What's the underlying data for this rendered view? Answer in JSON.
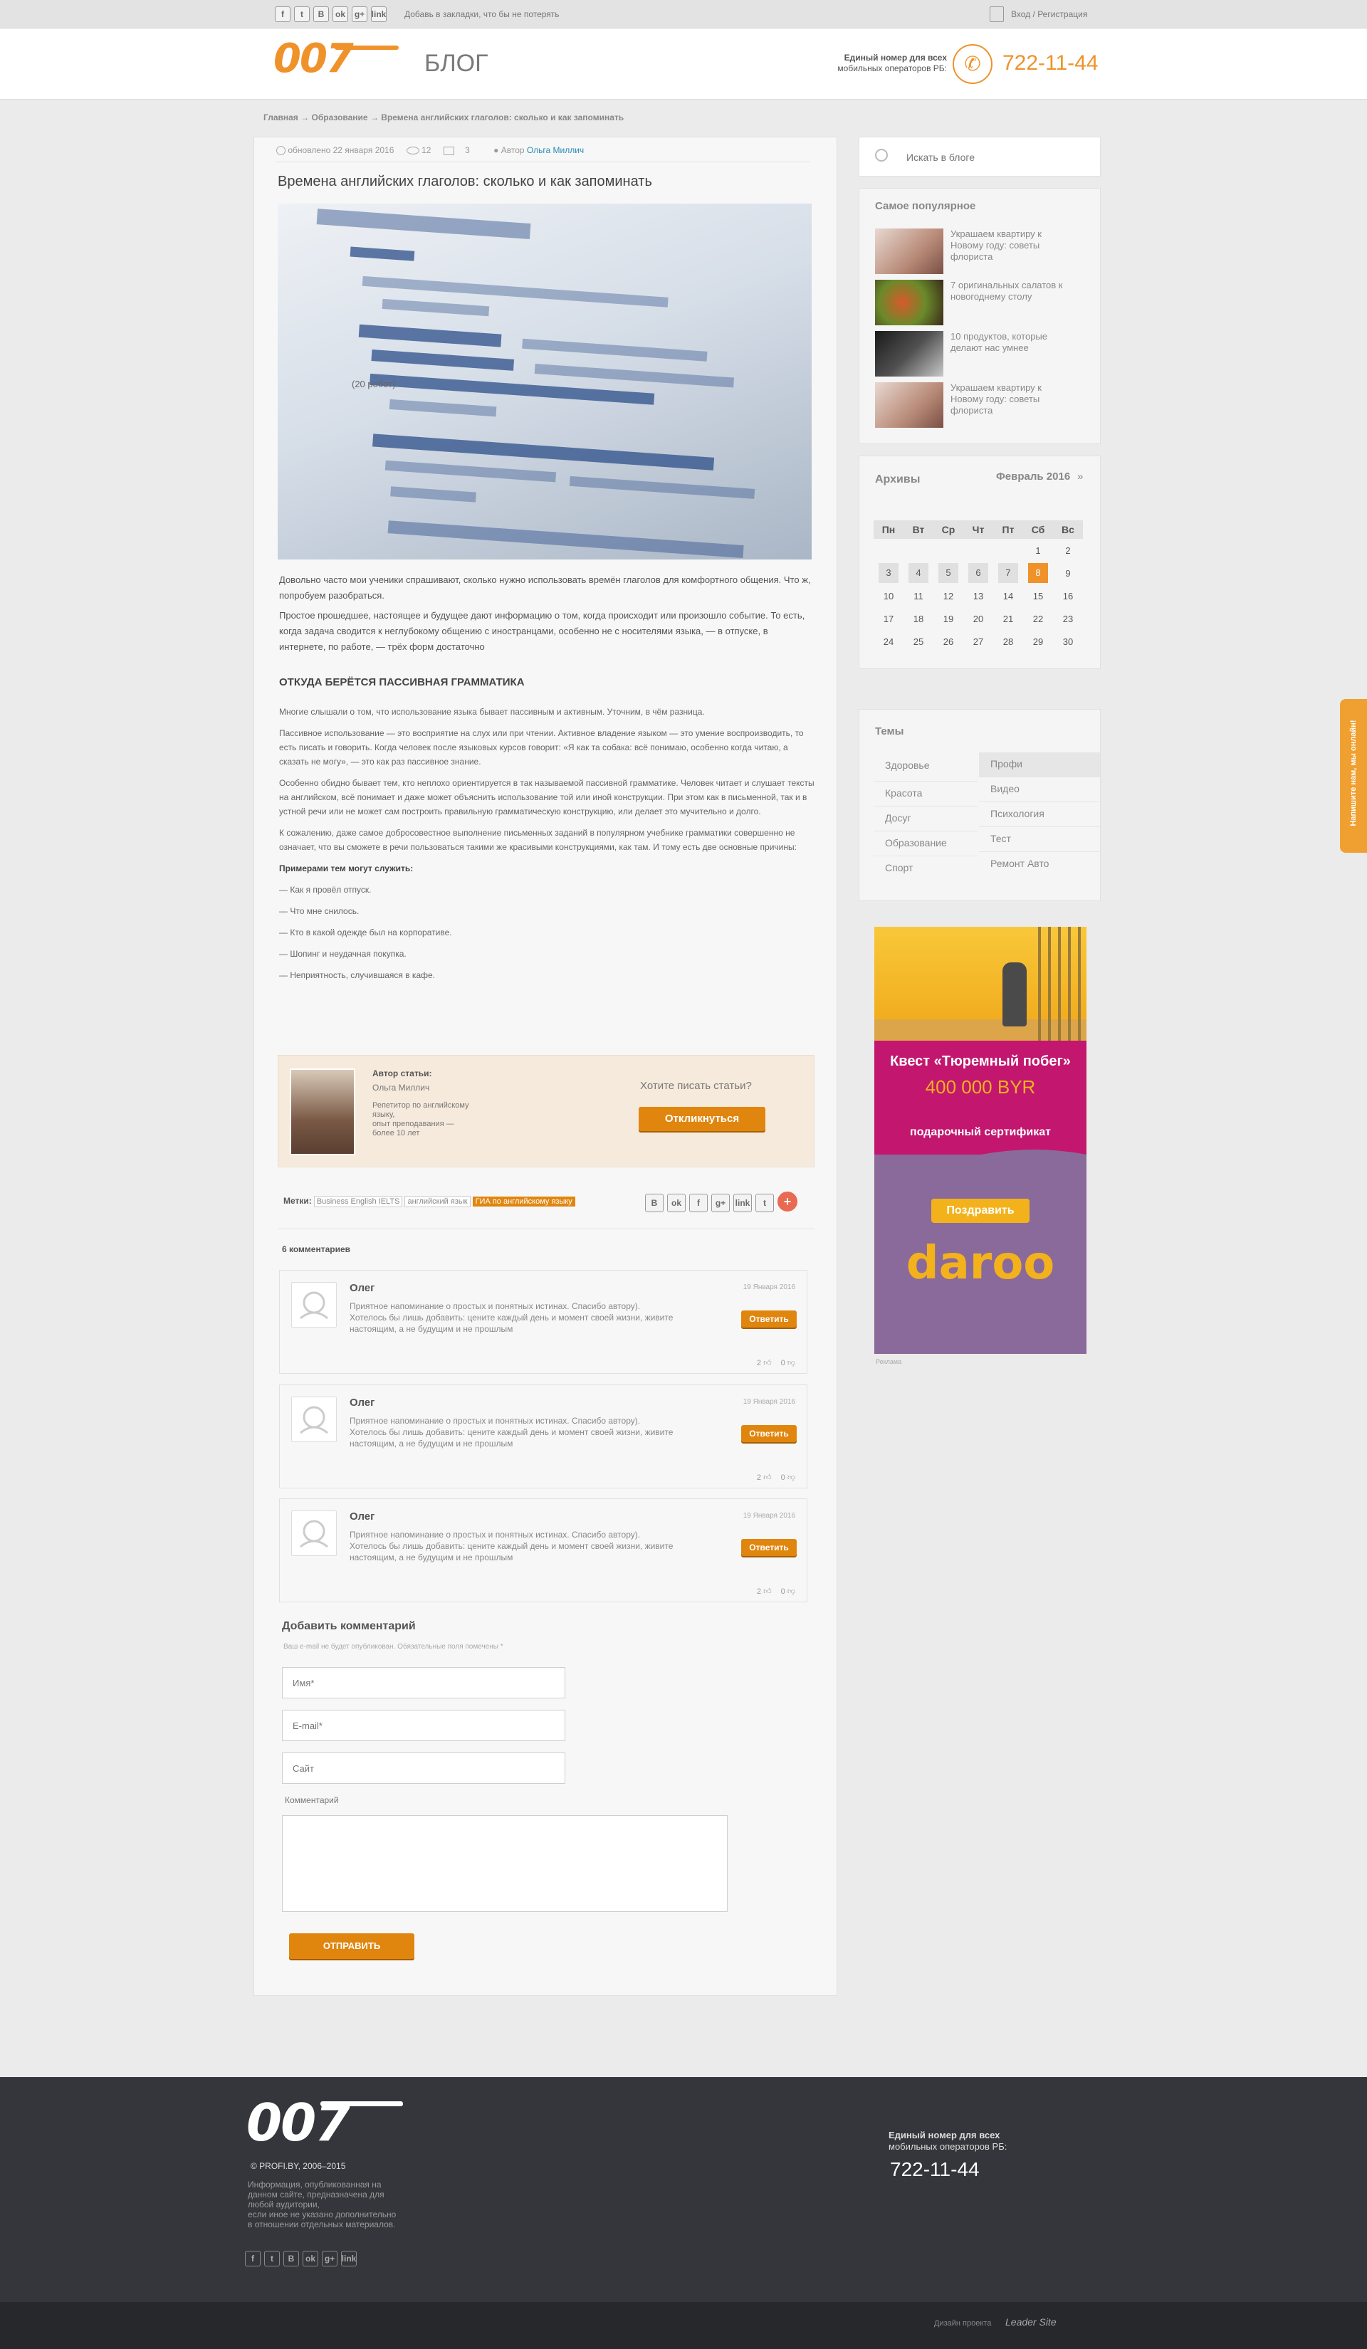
{
  "topbar": {
    "social_icons": [
      "f",
      "t",
      "B",
      "ok",
      "g+",
      "link"
    ],
    "bookmark_text": "Добавь в закладки, что бы не потерять",
    "login": "Вход",
    "separator": "/",
    "register": "Регистрация"
  },
  "header": {
    "logo": "007",
    "section_title": "БЛОГ",
    "phone_caption_1": "Единый номер для всех",
    "phone_caption_2": "мобильных операторов РБ:",
    "phone": "722-11-44"
  },
  "breadcrumb": {
    "items": [
      "Главная",
      "Образование",
      "Времена английских глаголов: сколько и как запоминать"
    ],
    "arrow": "→"
  },
  "article": {
    "updated": "обновлено 22 января 2016",
    "views": "12",
    "comments_count": "3",
    "author_label": "Автор",
    "author_name": "Ольга Миллич",
    "title": "Времена английских глаголов: сколько и как запоминать",
    "image_label": "(20 робот)",
    "intro": [
      "Довольно часто мои ученики спрашивают, сколько нужно использовать времён глаголов для комфортного общения. Что ж, попробуем разобраться.",
      "Простое прошедшее, настоящее и будущее дают информацию о том, когда происходит или произошло событие. То есть, когда задача сводится к неглубокому общению с иностранцами, особенно не с носителями языка, — в отпуске, в интернете, по работе, — трёх форм достаточно"
    ],
    "subheading": "ОТКУДА БЕРЁТСЯ ПАССИВНАЯ ГРАММАТИКА",
    "paragraphs": [
      "Многие слышали о том, что использование языка бывает пассивным и активным. Уточним, в чём разница.",
      "Пассивное использование — это восприятие на слух или при чтении. Активное владение языком — это умение воспроизводить, то есть писать и говорить. Когда человек после языковых курсов говорит: «Я как та собака: всё понимаю, особенно когда читаю, а сказать не могу», — это как раз пассивное знание.",
      "Особенно обидно бывает тем, кто неплохо ориентируется в так называемой пассивной грамматике. Человек читает и слушает тексты на английском, всё понимает и даже может объяснить использование той или иной конструкции. При этом как в письменной, так и в устной речи или не может сам построить правильную грамматическую конструкцию, или делает это мучительно и долго.",
      "К сожалению, даже самое добросовестное выполнение письменных заданий в популярном учебнике грамматики совершенно не означает, что вы сможете в речи пользоваться такими же красивыми конструкциями, как там. И тому есть две основные причины:"
    ],
    "examples_title": "Примерами тем могут служить:",
    "examples": [
      "— Как я провёл отпуск.",
      "— Что мне снилось.",
      "— Кто в какой одежде был на корпоративе.",
      "— Шопинг и неудачная покупка.",
      "— Неприятность, случившаяся в кафе."
    ]
  },
  "author_box": {
    "label": "Автор статьи:",
    "name": "Ольга Миллич",
    "desc_1": "Репетитор по английскому",
    "desc_2": "языку,",
    "desc_3": "опыт преподавания —",
    "desc_4": "более 10 лет",
    "question": "Хотите писать статьи?",
    "button": "Откликнуться"
  },
  "tags": {
    "label": "Метки:",
    "items": [
      "Business English IELTS",
      "английский язык",
      "ГИА по английскому языку"
    ],
    "share_icons": [
      "B",
      "ok",
      "f",
      "g+",
      "link",
      "t",
      "+"
    ]
  },
  "comments": {
    "count_label": "6 комментариев",
    "items": [
      {
        "author": "Олег",
        "date": "19 Января 2016",
        "line1": "Приятное напоминание о простых и понятных истинах. Спасибо автору).",
        "line2": "Хотелось бы лишь добавить: цените каждый день и момент своей жизни, живите",
        "line3": "настоящим, а не будущим и не прошлым",
        "reply": "Ответить",
        "likes": "2",
        "dislikes": "0"
      },
      {
        "author": "Олег",
        "date": "19 Января 2016",
        "line1": "Приятное напоминание о простых и понятных истинах. Спасибо автору).",
        "line2": "Хотелось бы лишь добавить: цените каждый день и момент своей жизни, живите",
        "line3": "настоящим, а не будущим и не прошлым",
        "reply": "Ответить",
        "likes": "2",
        "dislikes": "0"
      },
      {
        "author": "Олег",
        "date": "19 Января 2016",
        "line1": "Приятное напоминание о простых и понятных истинах. Спасибо автору).",
        "line2": "Хотелось бы лишь добавить: цените каждый день и момент своей жизни, живите",
        "line3": "настоящим, а не будущим и не прошлым",
        "reply": "Ответить",
        "likes": "2",
        "dislikes": "0"
      }
    ]
  },
  "form": {
    "title": "Добавить комментарий",
    "note": "Ваш e-mail не будет опубликован. Обязательные поля помечены *",
    "name_placeholder": "Имя*",
    "email_placeholder": "E-mail*",
    "site_placeholder": "Сайт",
    "comment_label": "Комментарий",
    "submit": "ОТПРАВИТЬ"
  },
  "sidebar": {
    "search_placeholder": "Искать в блоге",
    "popular_title": "Самое популярное",
    "popular": [
      {
        "l1": "Украшаем квартиру к",
        "l2": "Новому году: советы",
        "l3": "флориста"
      },
      {
        "l1": "7 оригинальных салатов к",
        "l2": "новогоднему столу",
        "l3": ""
      },
      {
        "l1": "10 продуктов, которые",
        "l2": "делают нас умнее",
        "l3": ""
      },
      {
        "l1": "Украшаем квартиру к",
        "l2": "Новому году: советы",
        "l3": "флориста"
      }
    ],
    "archive_title": "Архивы",
    "month": "Февраль 2016",
    "month_next": "»",
    "weekdays": [
      "Пн",
      "Вт",
      "Ср",
      "Чт",
      "Пт",
      "Сб",
      "Вс"
    ],
    "weeks": [
      [
        "",
        "",
        "",
        "",
        "",
        "1",
        "2"
      ],
      [
        "3",
        "4",
        "5",
        "6",
        "7",
        "8",
        "9"
      ],
      [
        "10",
        "11",
        "12",
        "13",
        "14",
        "15",
        "16"
      ],
      [
        "17",
        "18",
        "19",
        "20",
        "21",
        "22",
        "23"
      ],
      [
        "24",
        "25",
        "26",
        "27",
        "28",
        "29",
        "30"
      ]
    ],
    "today": "8",
    "topics_title": "Темы",
    "topics_left": [
      "Здоровье",
      "Красота",
      "Досуг",
      "Образование",
      "Спорт"
    ],
    "topics_right": [
      "Профи",
      "Видео",
      "Психология",
      "Тест",
      "Ремонт Авто"
    ],
    "ad": {
      "headline": "Квест «Тюремный побег»",
      "price": "400 000 BYR",
      "certificate": "подарочный сертификат",
      "button": "Поздравить",
      "brand": "daroo",
      "caption": "Реклама"
    }
  },
  "feedback_tab": "Напишите нам, мы онлайн!",
  "footer": {
    "logo": "007",
    "copyright": "© PROFI.BY, 2006–2015",
    "info_1": "Информация, опубликованная на",
    "info_2": "данном сайте, предназначена для",
    "info_3": "любой аудитории,",
    "info_4": "если иное не указано дополнительно",
    "info_5": "в отношении отдельных материалов.",
    "phone_caption_1": "Единый номер для всех",
    "phone_caption_2": "мобильных операторов РБ:",
    "phone": "722-11-44",
    "design_label": "Дизайн проекта",
    "design_brand": "Leader Site"
  },
  "colors": {
    "accent": "#f0922a",
    "button": "#e0860f",
    "footer": "#34363b",
    "footer_bottom": "#26282c",
    "ad_purple": "#8a6a9a",
    "ad_pink": "#c2166f",
    "ad_yellow": "#f3b21c"
  }
}
